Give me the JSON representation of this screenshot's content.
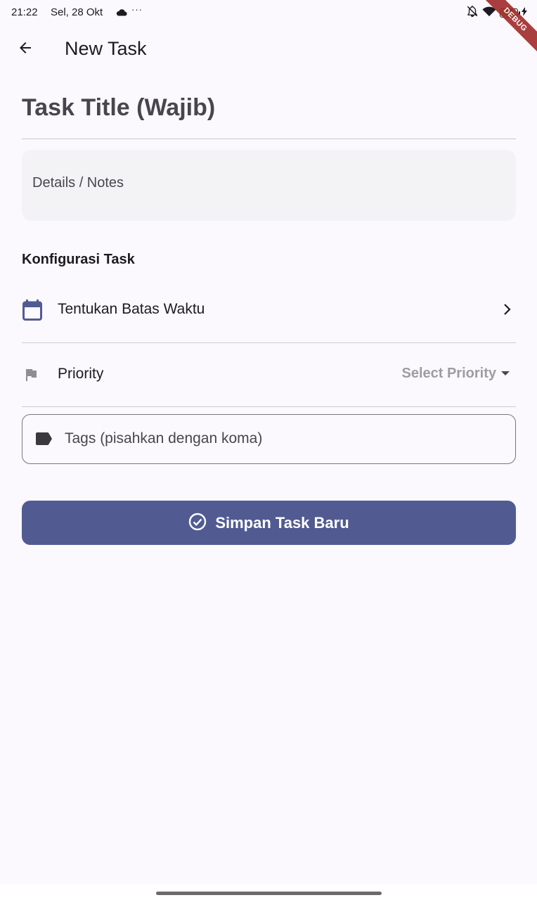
{
  "status_bar": {
    "time": "21:22",
    "date": "Sel, 28 Okt",
    "more": "···",
    "battery_level": "87",
    "icons": [
      "cloud-icon",
      "notifications-off-icon",
      "wifi-icon",
      "battery-icon",
      "charging-icon"
    ]
  },
  "debug_banner": "DEBUG",
  "app_bar": {
    "title": "New Task",
    "back_icon": "arrow-back-icon"
  },
  "form": {
    "title_placeholder": "Task Title (Wajib)",
    "title_value": "",
    "details_placeholder": "Details / Notes",
    "details_value": "",
    "section_title": "Konfigurasi Task",
    "deadline": {
      "label": "Tentukan Batas Waktu",
      "icon": "calendar-icon",
      "trailing_icon": "chevron-right-icon"
    },
    "priority": {
      "label": "Priority",
      "icon": "flag-icon",
      "selected_value": "Select Priority",
      "trailing_icon": "arrow-drop-down-icon"
    },
    "tags": {
      "placeholder": "Tags (pisahkan dengan koma)",
      "value": "",
      "icon": "label-icon"
    },
    "save_button": {
      "label": "Simpan Task Baru",
      "icon": "check-circle-icon"
    }
  },
  "colors": {
    "background": "#fbf8fe",
    "primary": "#515b92",
    "calendar_icon": "#515b92",
    "muted_text": "#9e9ca2",
    "divider": "#cfcdd3"
  }
}
